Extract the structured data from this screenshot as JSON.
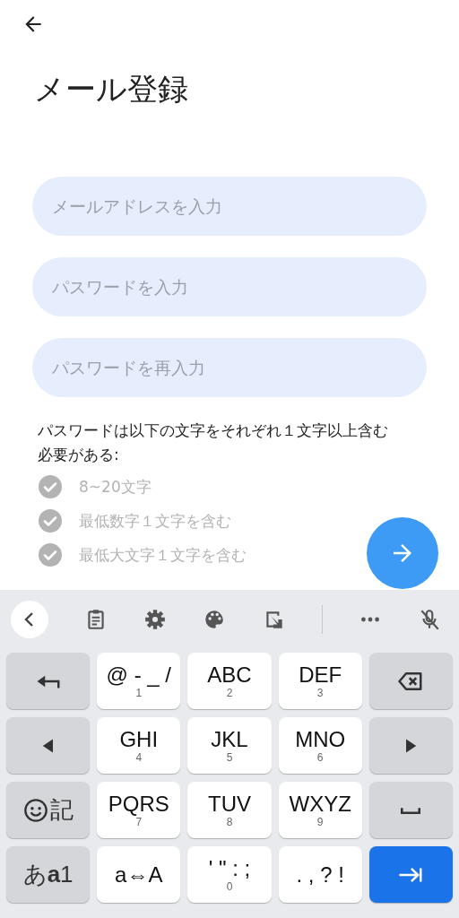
{
  "title": "メール登録",
  "fields": [
    {
      "placeholder": "メールアドレスを入力"
    },
    {
      "placeholder": "パスワードを入力"
    },
    {
      "placeholder": "パスワードを再入力"
    }
  ],
  "requirements": {
    "intro": "パスワードは以下の文字をそれぞれ１文字以上含む必要がある:",
    "items": [
      {
        "text": "8~20文字",
        "met": false
      },
      {
        "text": "最低数字１文字を含む",
        "met": false
      },
      {
        "text": "最低大文字１文字を含む",
        "met": false
      }
    ]
  },
  "keyboard": {
    "rows": [
      [
        {
          "kind": "enter"
        },
        {
          "kind": "char",
          "label": "@ - _ /",
          "digit": "1"
        },
        {
          "kind": "char",
          "label": "ABC",
          "digit": "2"
        },
        {
          "kind": "char",
          "label": "DEF",
          "digit": "3"
        },
        {
          "kind": "backspace"
        }
      ],
      [
        {
          "kind": "left"
        },
        {
          "kind": "char",
          "label": "GHI",
          "digit": "4"
        },
        {
          "kind": "char",
          "label": "JKL",
          "digit": "5"
        },
        {
          "kind": "char",
          "label": "MNO",
          "digit": "6"
        },
        {
          "kind": "right"
        }
      ],
      [
        {
          "kind": "emoji",
          "label": "記"
        },
        {
          "kind": "char",
          "label": "PQRS",
          "digit": "7"
        },
        {
          "kind": "char",
          "label": "TUV",
          "digit": "8"
        },
        {
          "kind": "char",
          "label": "WXYZ",
          "digit": "9"
        },
        {
          "kind": "space"
        }
      ],
      [
        {
          "kind": "mode",
          "label": "あ**a**1"
        },
        {
          "kind": "char",
          "label": "a⇔A"
        },
        {
          "kind": "char",
          "label": "' \" : ;",
          "digit": "0"
        },
        {
          "kind": "char",
          "label": ". , ? !"
        },
        {
          "kind": "tab"
        }
      ]
    ]
  }
}
